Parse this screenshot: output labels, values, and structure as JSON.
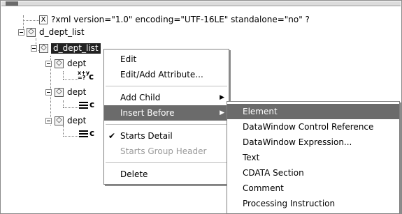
{
  "tree": {
    "xml_declaration": "?xml version=\"1.0\" encoding=\"UTF-16LE\" standalone=\"no\" ?",
    "root_label": "d_dept_list",
    "selected_label": "d_dept_list",
    "children": [
      {
        "label": "dept",
        "child_glyph": "x+y =?",
        "child_text": "c"
      },
      {
        "label": "dept",
        "child_glyph": "grid",
        "child_text": "c"
      },
      {
        "label": "dept",
        "child_glyph": "grid",
        "child_text": "c"
      }
    ]
  },
  "context_menu": {
    "items": [
      {
        "label": "Edit"
      },
      {
        "label": "Edit/Add Attribute..."
      },
      {
        "label": "Add Child"
      },
      {
        "label": "Insert Before"
      },
      {
        "label": "Starts Detail",
        "checked_mark": "✔"
      },
      {
        "label": "Starts Group Header"
      },
      {
        "label": "Delete"
      }
    ],
    "submenu_arrow": "▶"
  },
  "submenu": {
    "items": [
      {
        "label": "Element"
      },
      {
        "label": "DataWindow Control Reference"
      },
      {
        "label": "DataWindow Expression..."
      },
      {
        "label": "Text"
      },
      {
        "label": "CDATA Section"
      },
      {
        "label": "Comment"
      },
      {
        "label": "Processing Instruction"
      }
    ]
  },
  "colors": {
    "selection": "#222222",
    "menu_highlight": "#6b6b6b",
    "disabled_text": "#9a9a9a"
  }
}
